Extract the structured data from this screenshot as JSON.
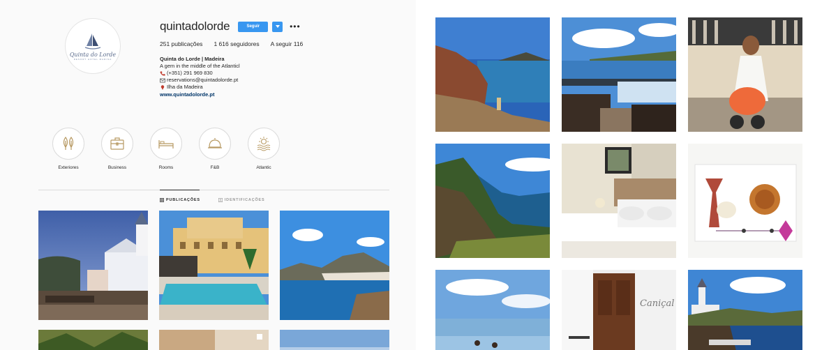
{
  "profile": {
    "username": "quintadolorde",
    "follow_label": "Seguir",
    "dropdown_icon": "caret-down-icon",
    "more_label": "•••",
    "logo_text": "Quinta do Lorde",
    "logo_sub": "RESORT HOTEL MARINA"
  },
  "stats": {
    "posts": "251 publicações",
    "followers": "1 616 seguidores",
    "following": "A seguir 116"
  },
  "bio": {
    "name": "Quinta do Lorde | Madeira",
    "tagline": "A gem in the middle of the Atlanticl",
    "phone": "(+351) 291 969 830",
    "email": "reservations@quintadolorde.pt",
    "location": "Ilha da Madeira",
    "website": "www.quintadolorde.pt"
  },
  "highlights": [
    {
      "label": "Exteriores",
      "icon": "trees-icon"
    },
    {
      "label": "Business",
      "icon": "briefcase-icon"
    },
    {
      "label": "Rooms",
      "icon": "bed-icon"
    },
    {
      "label": "F&B",
      "icon": "cloche-icon"
    },
    {
      "label": "Atlantic",
      "icon": "sun-waves-icon"
    }
  ],
  "tabs": [
    {
      "label": "PUBLICAÇÕES",
      "active": true
    },
    {
      "label": "IDENTIFICAÇÕES",
      "active": false
    }
  ],
  "colors": {
    "accent": "#3897f0",
    "link": "#003569",
    "icon_gold": "#b89a63",
    "phone_red": "#c0392b"
  }
}
